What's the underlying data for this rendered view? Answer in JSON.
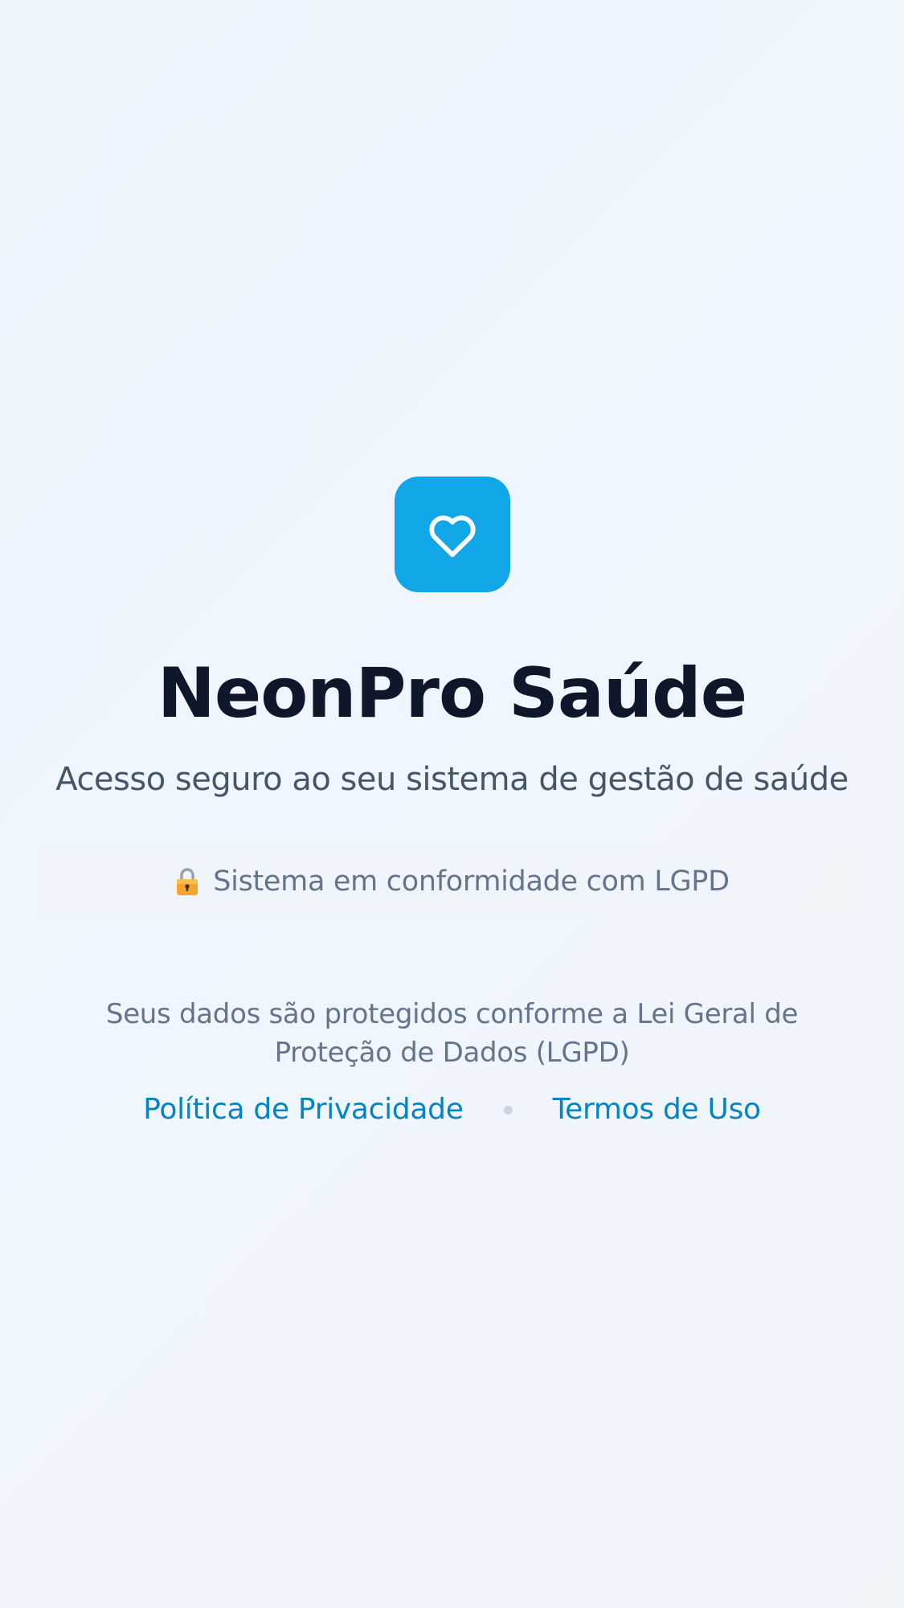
{
  "brand": {
    "title": "NeonPro Saúde",
    "subtitle": "Acesso seguro ao seu sistema de gestão de saúde",
    "logo_icon": "heart-icon",
    "accent_color": "#10a6e8"
  },
  "compliance": {
    "icon": "lock-icon",
    "text": "Sistema em conformidade com LGPD"
  },
  "footer": {
    "note": "Seus dados são protegidos conforme a Lei Geral de Proteção de Dados (LGPD)",
    "privacy_link": "Política de Privacidade",
    "terms_link": "Termos de Uso"
  }
}
